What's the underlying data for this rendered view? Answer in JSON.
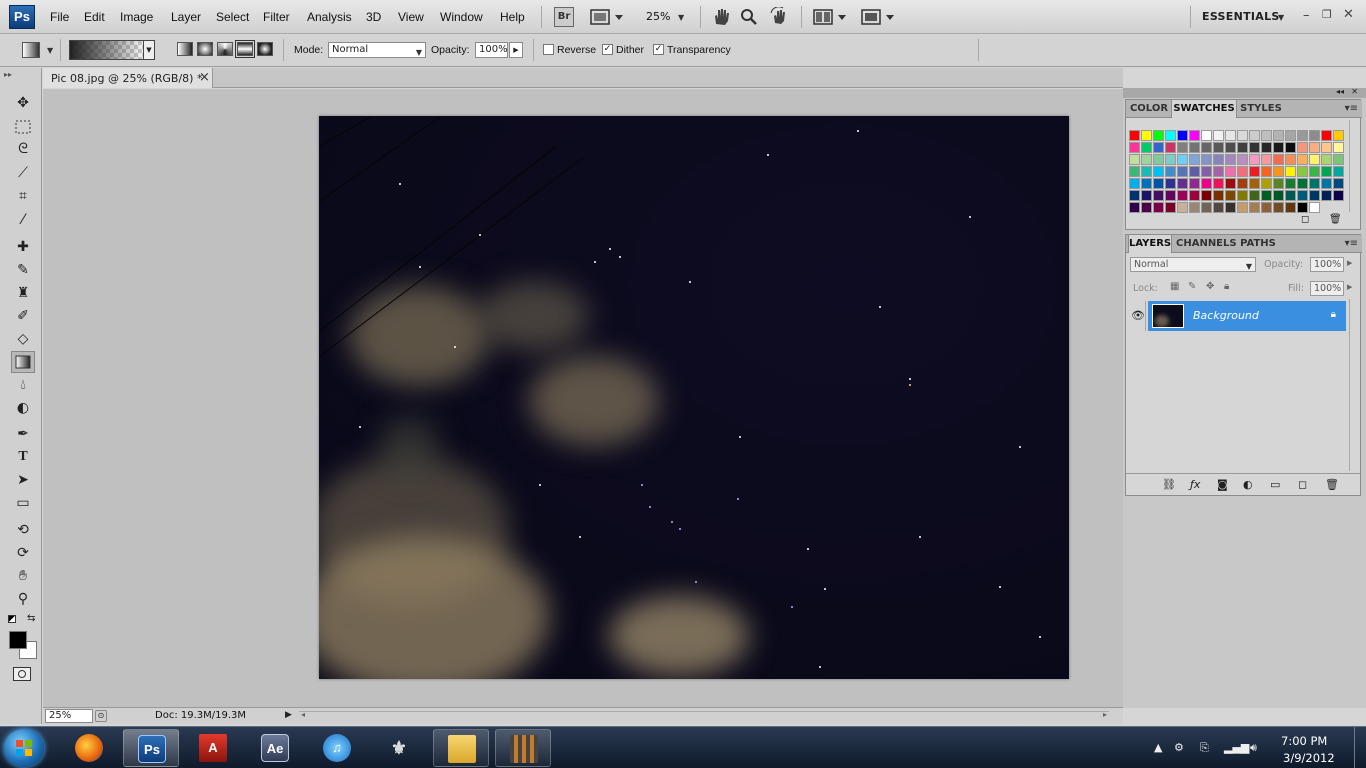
{
  "menubar": {
    "logo": "Ps",
    "items": [
      "File",
      "Edit",
      "Image",
      "Layer",
      "Select",
      "Filter",
      "Analysis",
      "3D",
      "View",
      "Window",
      "Help"
    ],
    "bridge_button": "Br",
    "zoom": "25%",
    "workspace": "ESSENTIALS"
  },
  "options": {
    "mode_label": "Mode:",
    "mode_value": "Normal",
    "opacity_label": "Opacity:",
    "opacity_value": "100%",
    "reverse_label": "Reverse",
    "reverse_checked": false,
    "dither_label": "Dither",
    "dither_checked": true,
    "transparency_label": "Transparency",
    "transparency_checked": true
  },
  "document": {
    "tab_title": "Pic 08.jpg @ 25% (RGB/8) *",
    "close_glyph": "×"
  },
  "status": {
    "zoom": "25%",
    "doc_size": "Doc: 19.3M/19.3M"
  },
  "panels": {
    "top_tabs": [
      "COLOR",
      "SWATCHES",
      "STYLES"
    ],
    "active_top_tab": "SWATCHES",
    "layer_tabs": [
      "LAYERS",
      "CHANNELS",
      "PATHS"
    ],
    "active_layer_tab": "LAYERS",
    "blend_mode": "Normal",
    "opacity_label": "Opacity:",
    "opacity_value": "100%",
    "lock_label": "Lock:",
    "fill_label": "Fill:",
    "fill_value": "100%",
    "layer_name": "Background"
  },
  "swatches": [
    [
      "#ff0000",
      "#ffff00",
      "#00ff00",
      "#00ffff",
      "#0000ff",
      "#ff00ff",
      "#ffffff",
      "#f2f2f2",
      "#e6e6e6",
      "#d9d9d9",
      "#cccccc",
      "#bfbfbf",
      "#b3b3b3",
      "#a6a6a6",
      "#999999",
      "#8c8c8c",
      "#ff0000",
      "#ffcc00"
    ],
    [
      "#ff3399",
      "#00cc66",
      "#3366cc",
      "#cc3366",
      "#808080",
      "#737373",
      "#666666",
      "#595959",
      "#4d4d4d",
      "#404040",
      "#333333",
      "#262626",
      "#1a1a1a",
      "#0d0d0d",
      "#f7977a",
      "#f9ad81",
      "#fdc68a",
      "#fff79a"
    ],
    [
      "#c4df9b",
      "#a3d39c",
      "#82ca9d",
      "#7bcdc8",
      "#6ecff6",
      "#7ea7d8",
      "#8493ca",
      "#8882be",
      "#a187be",
      "#bc8dbf",
      "#f49ac2",
      "#f6989d",
      "#f26c4f",
      "#f68e55",
      "#fbaf5c",
      "#fff467",
      "#acd372",
      "#7cc576"
    ],
    [
      "#3bb878",
      "#1abbb4",
      "#00bff3",
      "#438ccb",
      "#5574b9",
      "#605ca8",
      "#855fa8",
      "#a763a8",
      "#f06ea9",
      "#f26d7d",
      "#ed1c24",
      "#f26522",
      "#f7941d",
      "#fff200",
      "#8dc73f",
      "#39b54a",
      "#00a651",
      "#00a99d"
    ],
    [
      "#00aeef",
      "#0072bc",
      "#0054a6",
      "#2e3192",
      "#662d91",
      "#92278f",
      "#ec008c",
      "#ed145b",
      "#9e0b0f",
      "#a0410d",
      "#a36209",
      "#aba000",
      "#598527",
      "#197b30",
      "#007236",
      "#00746b",
      "#0076a3",
      "#004a80"
    ],
    [
      "#003471",
      "#1b1464",
      "#440e62",
      "#630460",
      "#9e005d",
      "#9e0039",
      "#790000",
      "#7b2e00",
      "#7d4900",
      "#827b00",
      "#406618",
      "#005e20",
      "#005826",
      "#005952",
      "#005b7f",
      "#003663",
      "#002157",
      "#0d004c"
    ],
    [
      "#32004b",
      "#4b0049",
      "#7b0046",
      "#7a0026",
      "#c7b299",
      "#998675",
      "#736357",
      "#534741",
      "#37302d",
      "#c69c6d",
      "#a67c52",
      "#8c6239",
      "#754c24",
      "#603913",
      "#000000",
      "#ffffff"
    ]
  ]
}
